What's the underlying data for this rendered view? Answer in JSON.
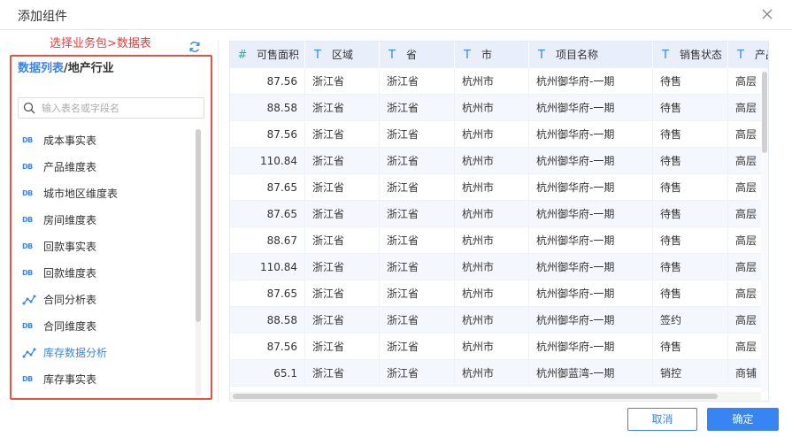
{
  "dialog": {
    "title": "添加组件"
  },
  "hint": "选择业务包>数据表",
  "breadcrumb": {
    "link": "数据列表",
    "separator": "/",
    "current": "地产行业"
  },
  "search": {
    "placeholder": "输入表名或字段名"
  },
  "tables": [
    {
      "label": "成本事实表",
      "icon": "db-icon",
      "active": false
    },
    {
      "label": "产品维度表",
      "icon": "db-icon",
      "active": false
    },
    {
      "label": "城市地区维度表",
      "icon": "db-icon",
      "active": false
    },
    {
      "label": "房间维度表",
      "icon": "db-icon",
      "active": false
    },
    {
      "label": "回款事实表",
      "icon": "db-icon",
      "active": false
    },
    {
      "label": "回款维度表",
      "icon": "db-icon",
      "active": false
    },
    {
      "label": "合同分析表",
      "icon": "analysis-icon",
      "active": false
    },
    {
      "label": "合同维度表",
      "icon": "db-icon",
      "active": false
    },
    {
      "label": "库存数据分析",
      "icon": "analysis-icon",
      "active": true
    },
    {
      "label": "库存事实表",
      "icon": "db-icon",
      "active": false
    }
  ],
  "db_icon_text": "DB",
  "grid": {
    "columns": [
      {
        "type": "#",
        "type_kind": "number",
        "label": "可售面积"
      },
      {
        "type": "T",
        "type_kind": "text",
        "label": "区域"
      },
      {
        "type": "T",
        "type_kind": "text",
        "label": "省"
      },
      {
        "type": "T",
        "type_kind": "text",
        "label": "市"
      },
      {
        "type": "T",
        "type_kind": "text",
        "label": "项目名称"
      },
      {
        "type": "T",
        "type_kind": "text",
        "label": "销售状态"
      },
      {
        "type": "T",
        "type_kind": "text",
        "label": "产品"
      }
    ],
    "rows": [
      [
        "87.56",
        "浙江省",
        "浙江省",
        "杭州市",
        "杭州御华府-一期",
        "待售",
        "高层"
      ],
      [
        "88.58",
        "浙江省",
        "浙江省",
        "杭州市",
        "杭州御华府-一期",
        "待售",
        "高层"
      ],
      [
        "87.56",
        "浙江省",
        "浙江省",
        "杭州市",
        "杭州御华府-一期",
        "待售",
        "高层"
      ],
      [
        "110.84",
        "浙江省",
        "浙江省",
        "杭州市",
        "杭州御华府-一期",
        "待售",
        "高层"
      ],
      [
        "87.65",
        "浙江省",
        "浙江省",
        "杭州市",
        "杭州御华府-一期",
        "待售",
        "高层"
      ],
      [
        "87.65",
        "浙江省",
        "浙江省",
        "杭州市",
        "杭州御华府-一期",
        "待售",
        "高层"
      ],
      [
        "88.67",
        "浙江省",
        "浙江省",
        "杭州市",
        "杭州御华府-一期",
        "待售",
        "高层"
      ],
      [
        "110.84",
        "浙江省",
        "浙江省",
        "杭州市",
        "杭州御华府-一期",
        "待售",
        "高层"
      ],
      [
        "87.65",
        "浙江省",
        "浙江省",
        "杭州市",
        "杭州御华府-一期",
        "待售",
        "高层"
      ],
      [
        "88.58",
        "浙江省",
        "浙江省",
        "杭州市",
        "杭州御华府-一期",
        "签约",
        "高层"
      ],
      [
        "87.56",
        "浙江省",
        "浙江省",
        "杭州市",
        "杭州御华府-一期",
        "待售",
        "高层"
      ],
      [
        "65.1",
        "浙江省",
        "浙江省",
        "杭州市",
        "杭州御蓝湾-一期",
        "销控",
        "商铺"
      ]
    ]
  },
  "buttons": {
    "cancel": "取消",
    "ok": "确定"
  },
  "colors": {
    "accent": "#3685f2",
    "hint_red": "#ec3b3b",
    "panel_border": "#e8533f",
    "header_bg": "#e9effa",
    "number_type": "#26b59a"
  }
}
